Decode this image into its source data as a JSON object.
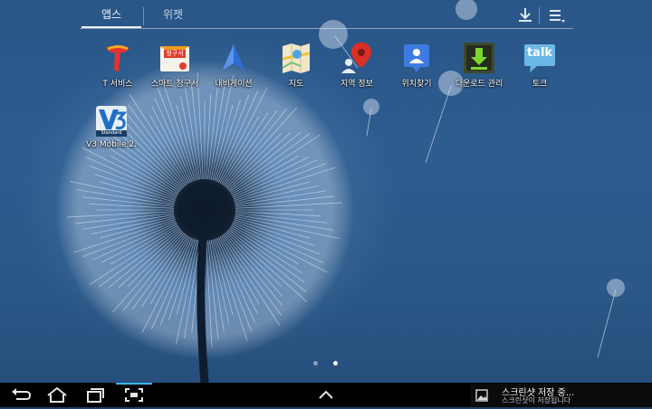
{
  "tabs": {
    "apps_label": "앱스",
    "widgets_label": "위젯"
  },
  "toolbar": {
    "download_icon": "download-icon",
    "menu_icon": "menu-icon"
  },
  "apps": [
    {
      "label": "T 서비스",
      "icon": "t-service-icon"
    },
    {
      "label": "스마트 청구서",
      "icon": "smart-bill-icon",
      "icon_text": "청구서"
    },
    {
      "label": "내비게이션",
      "icon": "navigation-icon"
    },
    {
      "label": "지도",
      "icon": "maps-icon"
    },
    {
      "label": "지역 정보",
      "icon": "local-info-icon"
    },
    {
      "label": "위치찾기",
      "icon": "latitude-icon"
    },
    {
      "label": "다운로드 관리",
      "icon": "download-manager-icon"
    },
    {
      "label": "토크",
      "icon": "talk-icon",
      "icon_text": "talk"
    },
    {
      "label": "V3 Mobile 2.",
      "icon": "v3-mobile-icon",
      "icon_text": "Standard"
    }
  ],
  "pager": {
    "pages": 2,
    "current": 2
  },
  "navbar": {
    "back_icon": "back-icon",
    "home_icon": "home-icon",
    "recent_icon": "recent-apps-icon",
    "screenshot_icon": "screen-capture-icon",
    "expand_icon": "chevron-up-icon"
  },
  "notification": {
    "title": "스크린샷 저장 중...",
    "subtitle": "스크린샷이 저장됩니다"
  },
  "colors": {
    "wallpaper": "#2b5888",
    "accent": "#39b3e8",
    "navbar": "#000000"
  }
}
